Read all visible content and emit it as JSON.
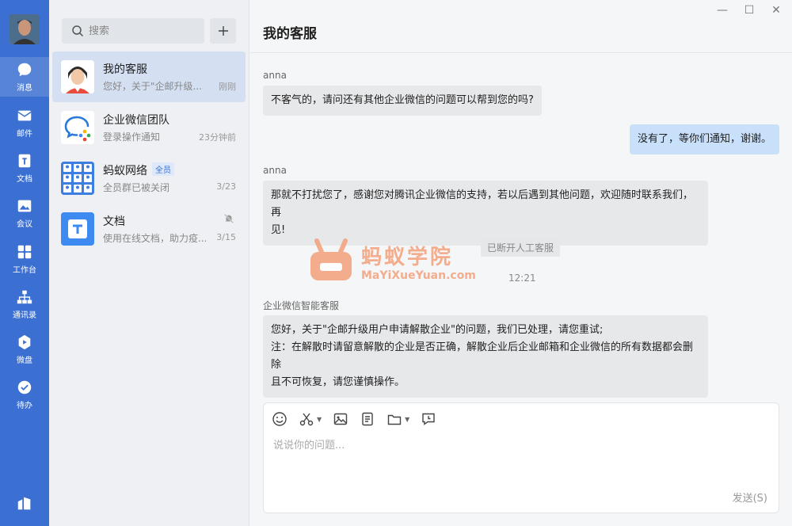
{
  "colors": {
    "rail": "#3b6fd1",
    "my_bubble": "#c9e0fb",
    "other_bubble": "#e7e8ea",
    "active_conv": "#d4dff1",
    "watermark": "#f3a07a"
  },
  "nav": {
    "items": [
      {
        "label": "消息",
        "icon": "chat-bubble-icon"
      },
      {
        "label": "邮件",
        "icon": "mail-icon"
      },
      {
        "label": "文档",
        "icon": "document-icon"
      },
      {
        "label": "会议",
        "icon": "meeting-icon"
      },
      {
        "label": "工作台",
        "icon": "workbench-grid-icon"
      },
      {
        "label": "通讯录",
        "icon": "org-chart-icon"
      },
      {
        "label": "微盘",
        "icon": "cloud-disk-icon"
      },
      {
        "label": "待办",
        "icon": "check-circle-icon"
      }
    ]
  },
  "search": {
    "placeholder": "搜索"
  },
  "conversations": [
    {
      "name": "我的客服",
      "preview": "您好，关于\"企邮升级...",
      "time": "刚刚",
      "badge": ""
    },
    {
      "name": "企业微信团队",
      "preview": "登录操作通知",
      "time": "23分钟前",
      "badge": ""
    },
    {
      "name": "蚂蚁网络",
      "preview": "全员群已被关闭",
      "time": "3/23",
      "badge": "全员"
    },
    {
      "name": "文档",
      "preview": "使用在线文档，助力疫...",
      "time": "3/15",
      "badge": ""
    }
  ],
  "chat": {
    "title": "我的客服",
    "messages": [
      {
        "sender": "anna",
        "text": "不客气的，请问还有其他企业微信的问题可以帮到您的吗?"
      },
      {
        "sender": "",
        "text": "没有了，等你们通知，谢谢。"
      },
      {
        "sender": "anna",
        "text_line1": "那就不打扰您了，感谢您对腾讯企业微信的支持，若以后遇到其他问题，欢迎随时联系我们，再",
        "text_line2": "见!"
      },
      {
        "sender": "企业微信智能客服",
        "text_line1": "您好，关于\"企邮升级用户申请解散企业\"的问题，我们已处理，请您重试;",
        "text_line2": "注：在解散时请留意解散的企业是否正确，解散企业后企业邮箱和企业微信的所有数据都会删除",
        "text_line3": "且不可恢复，请您谨慎操作。"
      }
    ],
    "system_note": "已断开人工客服",
    "time_note": "12:21",
    "watermark_cn": "蚂蚁学院",
    "watermark_en": "MaYiXueYuan.com"
  },
  "composer": {
    "placeholder": "说说你的问题...",
    "send_label": "发送(S)"
  }
}
